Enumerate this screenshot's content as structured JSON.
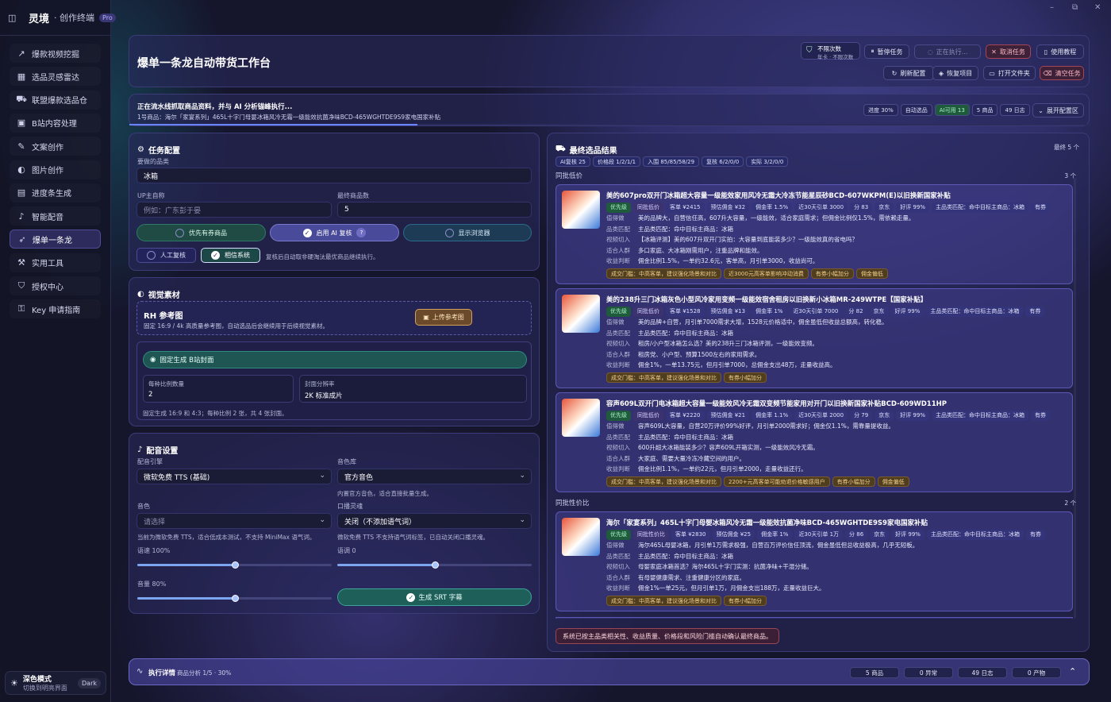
{
  "app": {
    "name": "灵境",
    "subtitle": "· 创作终端",
    "badge": "Pro"
  },
  "window": {
    "minimize": "–",
    "maximize": "⧉",
    "close": "✕"
  },
  "sidebar": {
    "items": [
      {
        "label": "爆款视频挖掘",
        "icon": "trend-icon"
      },
      {
        "label": "选品灵感雷达",
        "icon": "calendar-icon"
      },
      {
        "label": "联盟爆款选品仓",
        "icon": "cart-icon"
      },
      {
        "label": "B站内容处理",
        "icon": "bilibili-icon"
      },
      {
        "label": "文案创作",
        "icon": "pen-icon"
      },
      {
        "label": "图片创作",
        "icon": "palette-icon"
      },
      {
        "label": "进度条生成",
        "icon": "film-icon"
      },
      {
        "label": "智能配音",
        "icon": "mic-icon"
      },
      {
        "label": "爆单一条龙",
        "icon": "rocket-icon"
      },
      {
        "label": "实用工具",
        "icon": "wrench-icon"
      },
      {
        "label": "授权中心",
        "icon": "shield-icon"
      },
      {
        "label": "Key 申请指南",
        "icon": "key-icon"
      }
    ],
    "active_index": 8
  },
  "theme": {
    "title": "深色模式",
    "subtitle": "切换到明亮界面",
    "pill": "Dark"
  },
  "header": {
    "title": "爆单一条龙自动带货工作台",
    "quota": {
      "title": "不限次数",
      "sub": "年卡 · 不限次数"
    },
    "buttons": {
      "pause": "暂停任务",
      "running": "正在执行...",
      "cancel": "取消任务",
      "tutorial": "使用教程",
      "refresh": "刷新配置",
      "restore": "恢复项目",
      "open_folder": "打开文件夹",
      "clear": "清空任务"
    }
  },
  "status": {
    "line1": "正在流水线抓取商品资料，并与 AI 分析锚峰执行...",
    "line2": "1号商品：海尔「家宴系列」465L十字门母婴冰箱风冷无霜一级能效抗菌净味BCD-465WGHTDE9S9家电国家补贴",
    "progress_pct": 30,
    "chips": [
      "进度 30%",
      "自动选品",
      "AI可用 13",
      "5 商品",
      "49 日志"
    ],
    "expand": "展开配置区"
  },
  "task": {
    "title": "任务配置",
    "category_label": "要做的品类",
    "category_value": "冰箱",
    "up_label": "UP主自称",
    "up_placeholder": "例如：广东彭于晏",
    "count_label": "最终商品数",
    "count_value": "5",
    "toggles": {
      "coupon": "优先有券商品",
      "ai_review": "启用 AI 复核",
      "ai_info": "?",
      "browser": "显示浏览器",
      "manual": "人工复核",
      "trust": "相信系统"
    },
    "trust_note": "复核后自动取非硬淘汰最优商品继续执行。"
  },
  "visual": {
    "title": "视觉素材",
    "ref_title": "RH 参考图",
    "ref_desc": "固定 16:9 / 4k 高质量参考图，自动选品后会继续用于后续视觉素材。",
    "upload": "上传参考图",
    "cover_bar": "固定生成 B站封面",
    "per_ratio_label": "每种比例数量",
    "per_ratio_value": "2",
    "res_label": "封面分辨率",
    "res_value": "2K 标准成片",
    "note": "固定生成 16:9 和 4:3；每种比例 2 张，共 4 张封面。"
  },
  "voice": {
    "title": "配音设置",
    "engine_label": "配音引擎",
    "engine_value": "微软免费 TTS (基础)",
    "lib_label": "音色库",
    "lib_value": "官方音色",
    "lib_note": "内置官方音色，适合直接批量生成。",
    "timbre_label": "音色",
    "timbre_placeholder": "请选择",
    "style_label": "口播灵魂",
    "style_value": "关闭（不添加语气词）",
    "timbre_note": "当前为微软免费 TTS，适合低成本测试，不支持 MiniMax 语气词。",
    "style_note": "微软免费 TTS 不支持语气词标签，已自动关闭口播灵魂。",
    "speed_label": "语速 100%",
    "speed_fraction": 0.5,
    "pitch_label": "语调 0",
    "pitch_fraction": 0.5,
    "volume_label": "音量 80%",
    "volume_fraction": 0.5,
    "srt": "生成 SRT 字幕"
  },
  "results": {
    "title": "最终选品结果",
    "count": "最终 5 个",
    "tags": [
      "AI复核 25",
      "价格段 1/2/1/1",
      "入围 85/85/58/29",
      "复核 6/2/0/0",
      "实际 3/2/0/0"
    ],
    "groups": [
      {
        "label": "同批低价",
        "count": "3 个",
        "products": [
          {
            "title": "美的607pro双开门冰箱超大容量一级能效家用风冷无霜大冷冻节能星辰砂BCD-607WKPM(E)以旧换新国家补贴",
            "chips": [
              "优先级",
              "同批低价",
              "客单 ¥2415",
              "预估佣金 ¥32",
              "佣金率 1.5%",
              "近30天引单 3000",
              "分 83",
              "京东",
              "好评 99%",
              "主品类匹配：命中目标主商品：冰箱",
              "有券"
            ],
            "rows": [
              {
                "k": "值得做",
                "v": "美的品牌大，自营信任高，607升大容量，一级能效，适合家庭需求；但佣金比例仅1.5%，需依赖走量。"
              },
              {
                "k": "品类匹配",
                "v": "主品类匹配：命中目标主商品：冰箱"
              },
              {
                "k": "视频切入",
                "v": "【冰箱评测】美的607升双开门实拍：大容量到底能装多少？一级能效真的省电吗？"
              },
              {
                "k": "适合人群",
                "v": "多口家庭、大冰箱刚需用户，注重品牌和能效。"
              },
              {
                "k": "收益判断",
                "v": "佣金比例1.5%，一单约32.6元，客单高，月引单3000，收益尚可。"
              }
            ],
            "bottom": [
              "成交门槛：中高客单，建议强化场景和对比",
              "近3000元高客单影响冲动消费",
              "有券小幅加分",
              "佣金偏低"
            ]
          },
          {
            "title": "美的238升三门冰箱灰色小型风冷家用变频一级能效宿舍租房以旧换新小冰箱MR-249WTPE【国家补贴】",
            "chips": [
              "优先级",
              "同批低价",
              "客单 ¥1528",
              "预估佣金 ¥13",
              "佣金率 1%",
              "近30天引单 7000",
              "分 82",
              "京东",
              "好评 99%",
              "主品类匹配：命中目标主商品：冰箱",
              "有券"
            ],
            "rows": [
              {
                "k": "值得做",
                "v": "美的品牌+自营，月引单7000需求大增，1528元价格适中，佣金虽低但收益总额高，转化稳。"
              },
              {
                "k": "品类匹配",
                "v": "主品类匹配：命中目标主商品：冰箱"
              },
              {
                "k": "视频切入",
                "v": "租房/小户型冰箱怎么选？美的238升三门冰箱评测，一级能效变频。"
              },
              {
                "k": "适合人群",
                "v": "租房党、小户型、预算1500左右的家用需求。"
              },
              {
                "k": "收益判断",
                "v": "佣金1%，一单13.75元，但月引单7000，总佣金支出48万，走量收益高。"
              }
            ],
            "bottom": [
              "成交门槛：中高客单，建议强化场景和对比",
              "有券小幅加分"
            ]
          },
          {
            "title": "容声609L双开门电冰箱超大容量一级能效风冷无霜双变频节能家用对开门以旧换新国家补贴BCD-609WD11HP",
            "chips": [
              "优先级",
              "同批低价",
              "客单 ¥2220",
              "预估佣金 ¥21",
              "佣金率 1.1%",
              "近30天引单 2000",
              "分 79",
              "京东",
              "好评 99%",
              "主品类匹配：命中目标主商品：冰箱",
              "有券"
            ],
            "rows": [
              {
                "k": "值得做",
                "v": "容声609L大容量，自营20万评价99%好评，月引单2000需求好；佣金仅1.1%，需靠量提收益。"
              },
              {
                "k": "品类匹配",
                "v": "主品类匹配：命中目标主商品：冰箱"
              },
              {
                "k": "视频切入",
                "v": "600升超大冰箱能装多少？容声609L开箱实测，一级能效风冷无霜。"
              },
              {
                "k": "适合人群",
                "v": "大家庭、需要大量冷冻冷藏空间的用户。"
              },
              {
                "k": "收益判断",
                "v": "佣金比例1.1%，一单约22元，但月引单2000，走量收益还行。"
              }
            ],
            "bottom": [
              "成交门槛：中高客单，建议强化场景和对比",
              "2200+元高客单可能劝退价格敏感用户",
              "有券小幅加分",
              "佣金偏低"
            ]
          }
        ]
      },
      {
        "label": "同批性价比",
        "count": "2 个",
        "products": [
          {
            "title": "海尔「家宴系列」465L十字门母婴冰箱风冷无霜一级能效抗菌净味BCD-465WGHTDE9S9家电国家补贴",
            "chips": [
              "优先级",
              "同批性价比",
              "客单 ¥2830",
              "预估佣金 ¥25",
              "佣金率 1%",
              "近30天引单 1万",
              "分 86",
              "京东",
              "好评 99%",
              "主品类匹配：命中目标主商品：冰箱",
              "有券"
            ],
            "rows": [
              {
                "k": "值得做",
                "v": "海尔465L母婴冰箱，月引单1万需求极强，自营百万评价信任顶流，佣金虽低但总收益极高，几乎无短板。"
              },
              {
                "k": "品类匹配",
                "v": "主品类匹配：命中目标主商品：冰箱"
              },
              {
                "k": "视频切入",
                "v": "母婴家庭冰箱首选？海尔465L十字门实测：抗菌净味+干湿分储。"
              },
              {
                "k": "适合人群",
                "v": "有母婴健康需求、注重健康分区的家庭。"
              },
              {
                "k": "收益判断",
                "v": "佣金1%一单25元，但月引单1万，月佣金支出188万，走量收益巨大。"
              }
            ],
            "bottom": [
              "成交门槛：中高客单，建议强化场景和对比",
              "有券小幅加分"
            ]
          }
        ]
      }
    ],
    "footer_note": "系统已按主品类相关性、收益质量、价格段和风险门槛自动确认最终商品。"
  },
  "exec": {
    "title": "执行详情",
    "sub": "商品分析 1/5 · 30%",
    "stats": [
      "5 商品",
      "0 异常",
      "49 日志",
      "0 产物"
    ]
  }
}
